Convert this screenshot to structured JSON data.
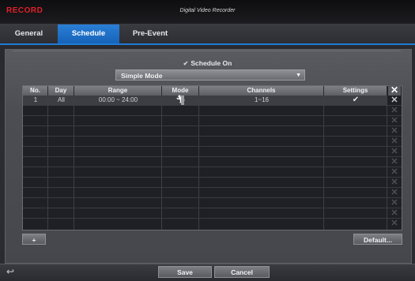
{
  "titlebar": {
    "brand": "RECORD",
    "app_title": "Digital Video Recorder"
  },
  "tabs": [
    {
      "label": "General",
      "active": false
    },
    {
      "label": "Schedule",
      "active": true
    },
    {
      "label": "Pre-Event",
      "active": false
    }
  ],
  "schedule": {
    "schedule_on_label": "Schedule On",
    "schedule_on_checked": true,
    "mode_value": "Simple Mode"
  },
  "grid": {
    "columns": [
      "No.",
      "Day",
      "Range",
      "Mode",
      "Channels",
      "Settings"
    ],
    "rows": [
      {
        "no": "1",
        "day": "All",
        "range": "00:00 ~ 24:00",
        "mode_icon": "running-man-icon",
        "channels": "1~16",
        "settings_icon": "checkmark-icon"
      }
    ],
    "empty_rows": 13
  },
  "buttons": {
    "add": "+",
    "default": "Default...",
    "save": "Save",
    "cancel": "Cancel"
  },
  "colors": {
    "accent": "#1f7bd6",
    "brand": "#e0202a"
  }
}
